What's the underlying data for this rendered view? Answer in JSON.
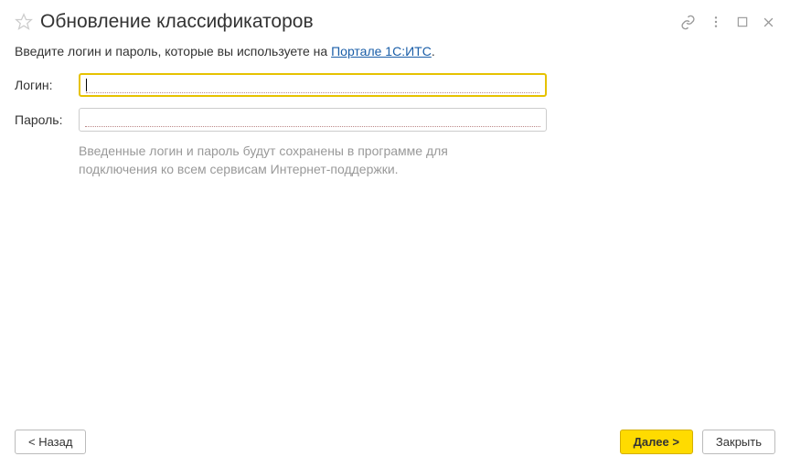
{
  "window": {
    "title": "Обновление классификаторов"
  },
  "intro": {
    "prefix": "Введите логин и пароль, которые вы используете на ",
    "link_text": "Портале 1С:ИТС",
    "suffix": "."
  },
  "form": {
    "login_label": "Логин:",
    "login_value": "",
    "password_label": "Пароль:",
    "password_value": ""
  },
  "hint": {
    "line1": "Введенные логин и пароль будут сохранены в программе для",
    "line2": "подключения ко всем сервисам Интернет-поддержки."
  },
  "buttons": {
    "back": "< Назад",
    "next": "Далее >",
    "close": "Закрыть"
  }
}
